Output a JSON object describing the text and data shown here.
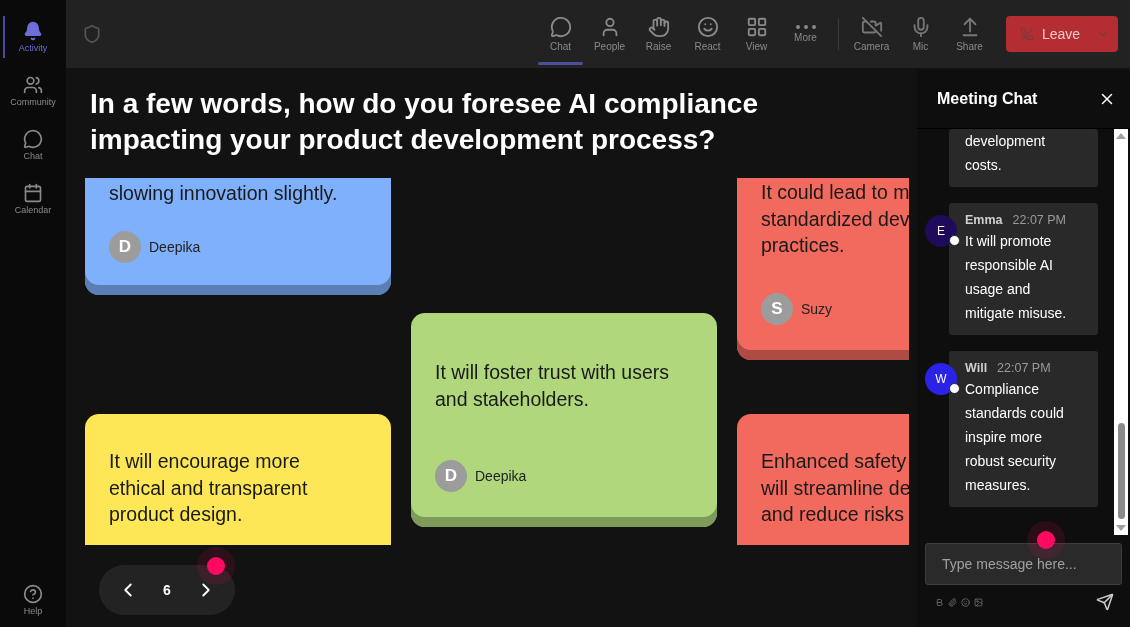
{
  "sidebar": {
    "items": [
      {
        "kind": "activity",
        "label": "Activity",
        "selected": true
      },
      {
        "kind": "community",
        "label": "Community",
        "selected": false
      },
      {
        "kind": "chat",
        "label": "Chat",
        "selected": false
      },
      {
        "kind": "calendar",
        "label": "Calendar",
        "selected": false
      }
    ],
    "help": "Help"
  },
  "toolbar": {
    "items": [
      {
        "kind": "chat",
        "label": "Chat",
        "selected": true
      },
      {
        "kind": "people",
        "label": "People",
        "selected": false
      },
      {
        "kind": "raise",
        "label": "Raise",
        "selected": false
      },
      {
        "kind": "react",
        "label": "React",
        "selected": false
      },
      {
        "kind": "view",
        "label": "View",
        "selected": false
      },
      {
        "kind": "more",
        "label": "More",
        "selected": false
      }
    ],
    "devices": [
      {
        "kind": "camera",
        "label": "Camera"
      },
      {
        "kind": "mic",
        "label": "Mic"
      },
      {
        "kind": "share",
        "label": "Share"
      }
    ],
    "leave_button": "Leave"
  },
  "question": "In a few words, how do you foresee AI compliance impacting your product development process?",
  "board": {
    "cards": [
      {
        "color": "#7fb0fb",
        "text": "slowing innovation slightly.",
        "author": "Deepika",
        "initial": "D"
      },
      {
        "color": "#b0d77c",
        "text": "It will foster trust with users\nand stakeholders.",
        "author": "Deepika",
        "initial": "D"
      },
      {
        "color": "#f2695e",
        "text": "It could lead to m\nstandardized dev\npractices.",
        "author": "Suzy",
        "initial": "S"
      },
      {
        "color": "#fde757",
        "text": "It will encourage more\nethical and transparent\nproduct design."
      },
      {
        "color": "#f2695e",
        "text": "Enhanced safety\nwill streamline de\nand reduce risks"
      }
    ]
  },
  "pager": {
    "page": "6"
  },
  "chat": {
    "title": "Meeting Chat",
    "messages": [
      {
        "text": "development costs."
      },
      {
        "author": "Emma",
        "initial": "E",
        "color": "#1f0b5a",
        "time": "22:07 PM",
        "text": "It will promote responsible AI usage and mitigate misuse."
      },
      {
        "author": "Will",
        "initial": "W",
        "color": "#2b22e8",
        "time": "22:07 PM",
        "text": "Compliance standards could inspire more robust security measures."
      }
    ],
    "input": {
      "placeholder": "Type message here..."
    }
  }
}
